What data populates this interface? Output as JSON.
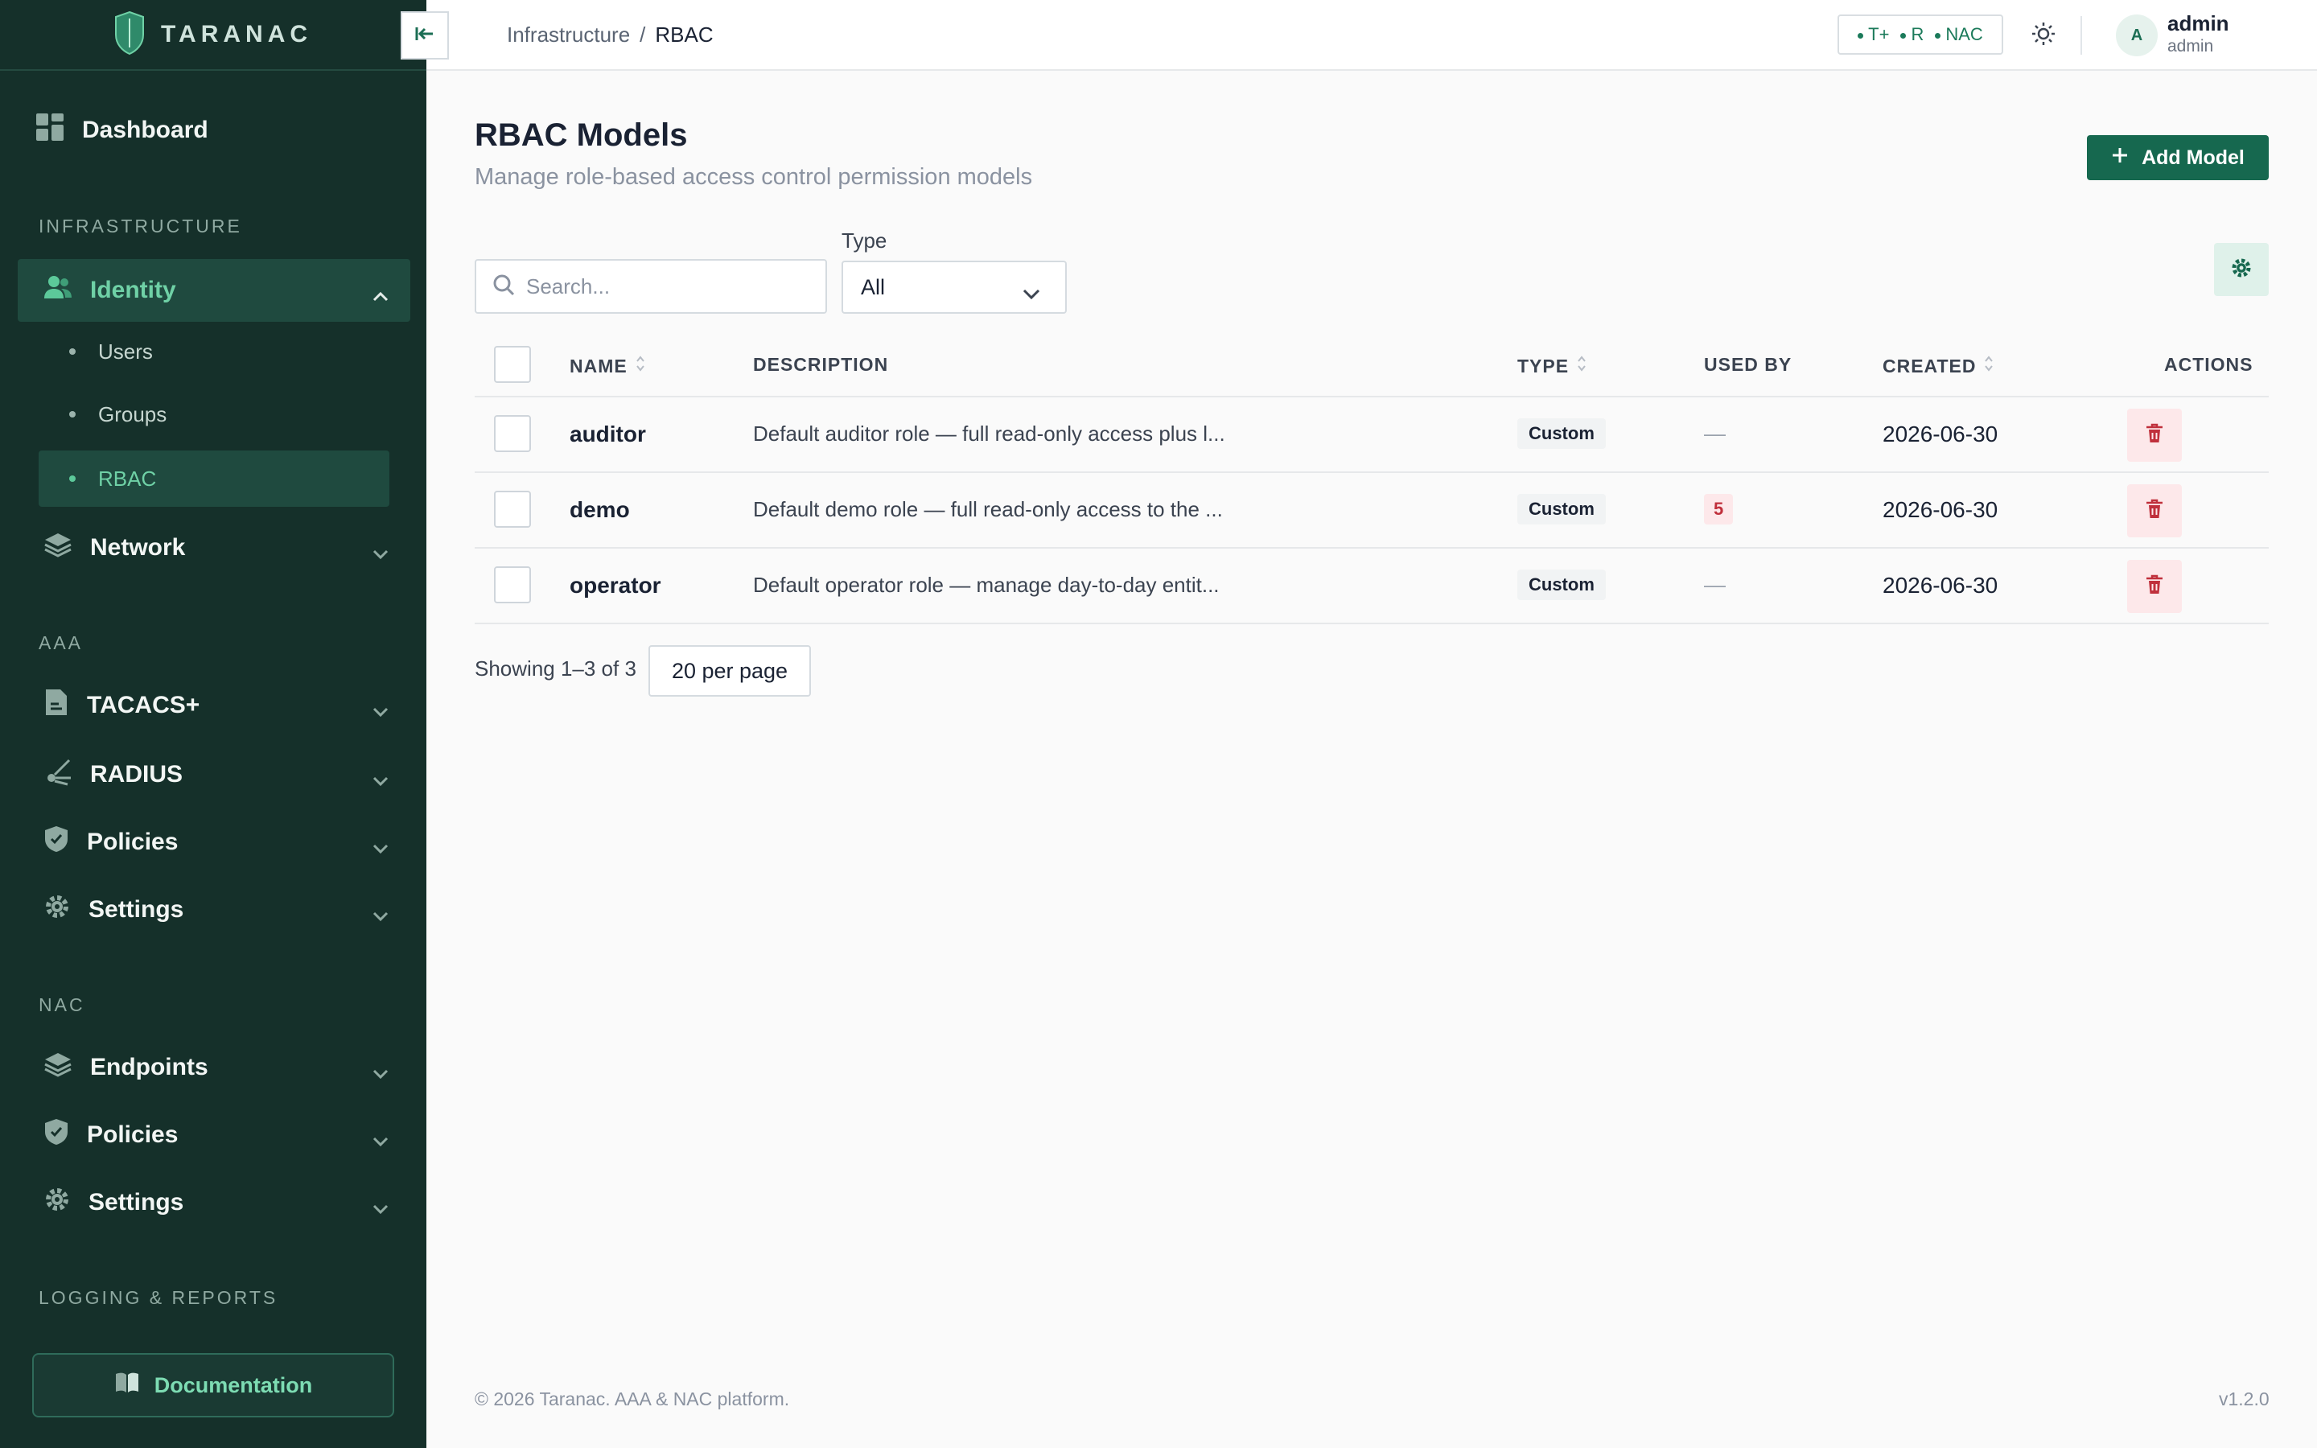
{
  "brand": {
    "name": "TARANAC"
  },
  "sidebar": {
    "dashboard": "Dashboard",
    "sections": {
      "infrastructure": "INFRASTRUCTURE",
      "aaa": "AAA",
      "nac": "NAC",
      "logging": "LOGGING & REPORTS"
    },
    "identity": {
      "label": "Identity",
      "children": [
        "Users",
        "Groups",
        "RBAC"
      ]
    },
    "network": "Network",
    "aaa_items": [
      "TACACS+",
      "RADIUS",
      "Policies",
      "Settings"
    ],
    "nac_items": [
      "Endpoints",
      "Policies",
      "Settings"
    ],
    "documentation": "Documentation"
  },
  "topbar": {
    "breadcrumb": [
      "Infrastructure",
      "RBAC"
    ],
    "breadcrumb_sep": "/",
    "status": [
      "T+",
      "R",
      "NAC"
    ],
    "user": {
      "initial": "A",
      "name": "admin",
      "role": "admin"
    }
  },
  "page": {
    "title": "RBAC Models",
    "subtitle": "Manage role-based access control permission models",
    "add_label": "Add Model",
    "search_placeholder": "Search...",
    "type_label": "Type",
    "type_value": "All"
  },
  "table": {
    "headers": {
      "name": "NAME",
      "description": "DESCRIPTION",
      "type": "TYPE",
      "used_by": "USED BY",
      "created": "CREATED",
      "actions": "ACTIONS"
    },
    "rows": [
      {
        "name": "auditor",
        "description": "Default auditor role — full read-only access plus l...",
        "type": "Custom",
        "used_by": "—",
        "created": "2026-06-30"
      },
      {
        "name": "demo",
        "description": "Default demo role — full read-only access to the ...",
        "type": "Custom",
        "used_by": "5",
        "created": "2026-06-30"
      },
      {
        "name": "operator",
        "description": "Default operator role — manage day-to-day entit...",
        "type": "Custom",
        "used_by": "—",
        "created": "2026-06-30"
      }
    ]
  },
  "pagination": {
    "showing": "Showing 1–3 of 3",
    "per_page": "20 per page"
  },
  "footer": {
    "copyright": "© 2026 Taranac. AAA & NAC platform.",
    "version": "v1.2.0"
  },
  "colors": {
    "sidebar_bg": "#15302a",
    "accent": "#16684f",
    "active_text": "#6fd1a6",
    "danger": "#c0303c"
  }
}
